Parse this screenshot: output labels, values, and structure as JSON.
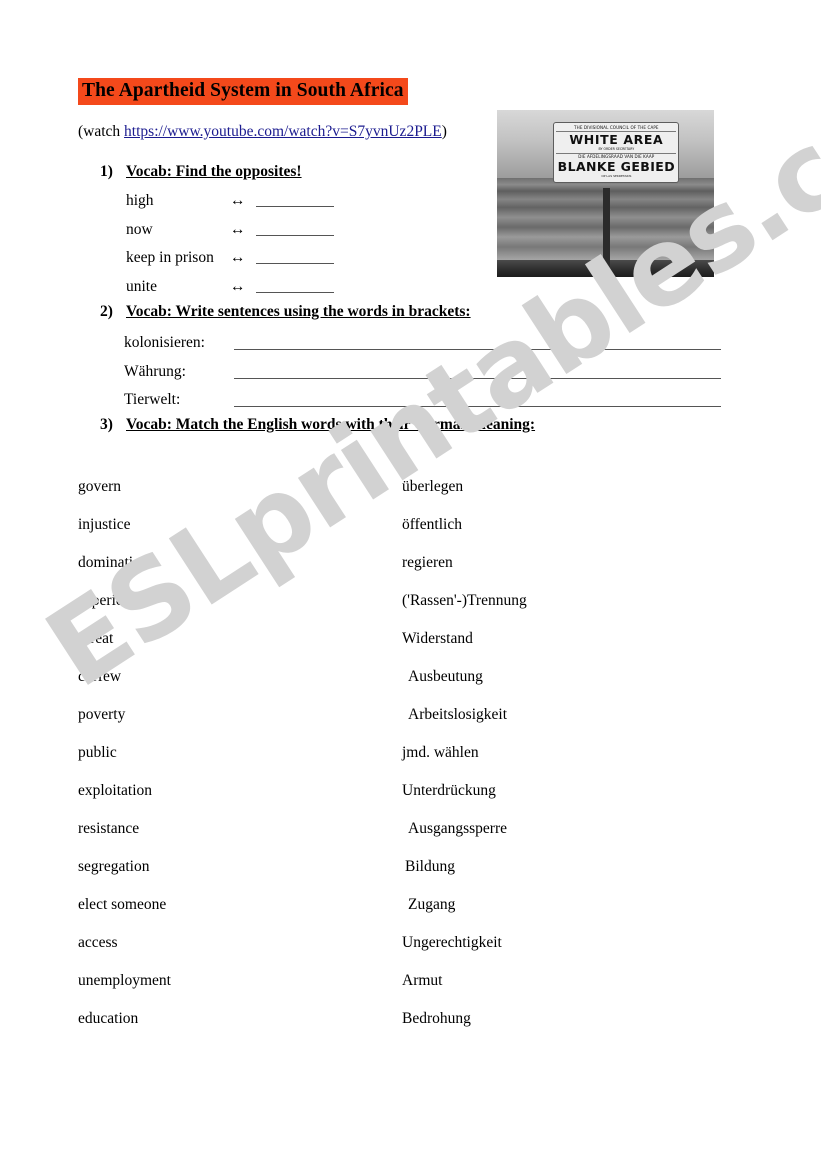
{
  "document": {
    "title": "The Apartheid System in South Africa",
    "title_highlight_color": "#f4491b",
    "watermark": "ESLprintables.com",
    "watermark_color": "#d2d2d2"
  },
  "watch": {
    "prefix": "(watch ",
    "url": "https://www.youtube.com/watch?v=S7yvnUz2PLE",
    "suffix": ")",
    "link_color": "#1b1b8f"
  },
  "photo": {
    "alt": "Apartheid era beach sign at the sea",
    "sign": {
      "line1": "THE DIVISIONAL COUNCIL OF THE CAPE",
      "line2": "WHITE AREA",
      "line2_sub": "BY ORDER SECRETARY",
      "line3": "DIE AFDELINGSRAAD VAN DIE KAAP",
      "line4": "BLANKE GEBIED",
      "line4_sub": "OP LAS SEKRETARIS"
    }
  },
  "exercises": [
    {
      "number": "1)",
      "heading": "Vocab: Find the opposites!"
    },
    {
      "number": "2)",
      "heading": "Vocab: Write sentences using the words in brackets:"
    },
    {
      "number": "3)",
      "heading": "Vocab: Match the English words with their German meaning:"
    }
  ],
  "opposites": [
    {
      "word": "high",
      "arrow": "↔"
    },
    {
      "word": "now",
      "arrow": "↔"
    },
    {
      "word": "keep in prison",
      "arrow": "↔"
    },
    {
      "word": "unite",
      "arrow": "↔"
    }
  ],
  "sentences": [
    {
      "label": "kolonisieren:"
    },
    {
      "label": "Währung:"
    },
    {
      "label": "Tierwelt:"
    }
  ],
  "matching": {
    "english": [
      "govern",
      "injustice",
      "domination",
      "superior",
      "threat",
      "curfew",
      "poverty",
      "public",
      "exploitation",
      "resistance",
      "segregation",
      "elect someone",
      "access",
      "unemployment",
      "education"
    ],
    "german": [
      "überlegen",
      "öffentlich",
      "regieren",
      "('Rassen'-)Trennung",
      "Widerstand",
      "Ausbeutung",
      "Arbeitslosigkeit",
      "jmd. wählen",
      "Unterdrückung",
      "Ausgangssperre",
      "Bildung",
      "Zugang",
      "Ungerechtigkeit",
      "Armut",
      "Bedrohung"
    ]
  }
}
